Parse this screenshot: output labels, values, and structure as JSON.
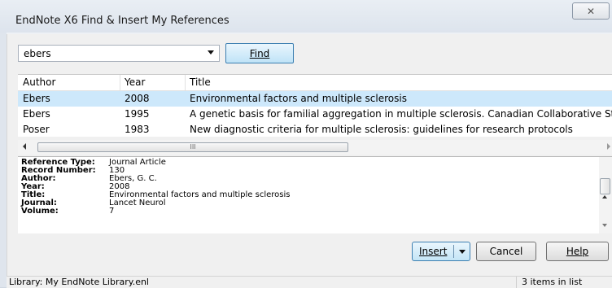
{
  "window": {
    "title": "EndNote X6 Find & Insert My References",
    "close_glyph": "✕"
  },
  "search": {
    "value": "ebers",
    "find_label": "Find"
  },
  "table": {
    "columns": [
      "Author",
      "Year",
      "Title"
    ],
    "rows": [
      {
        "author": "Ebers",
        "year": "2008",
        "title": "Environmental factors and multiple sclerosis",
        "selected": true
      },
      {
        "author": "Ebers",
        "year": "1995",
        "title": "A genetic basis for familial aggregation in multiple sclerosis. Canadian Collaborative Study Group",
        "selected": false
      },
      {
        "author": "Poser",
        "year": "1983",
        "title": "New diagnostic criteria for multiple sclerosis: guidelines for research protocols",
        "selected": false
      }
    ],
    "scroll_grip": "III"
  },
  "preview": {
    "lines": [
      {
        "key": "Reference Type:",
        "value": "Journal Article"
      },
      {
        "key": "Record Number:",
        "value": "130"
      },
      {
        "key": "Author:",
        "value": "Ebers, G. C."
      },
      {
        "key": "Year:",
        "value": "2008"
      },
      {
        "key": "Title:",
        "value": "Environmental factors and multiple sclerosis"
      },
      {
        "key": "Journal:",
        "value": "Lancet Neurol"
      },
      {
        "key": "Volume:",
        "value": "7"
      }
    ]
  },
  "buttons": {
    "insert": "Insert",
    "cancel": "Cancel",
    "help": "Help"
  },
  "status": {
    "library": "Library: My EndNote Library.enl",
    "count": "3 items in list"
  },
  "colors": {
    "selection": "#cde8fb",
    "accent_border": "#3c7fb1"
  }
}
